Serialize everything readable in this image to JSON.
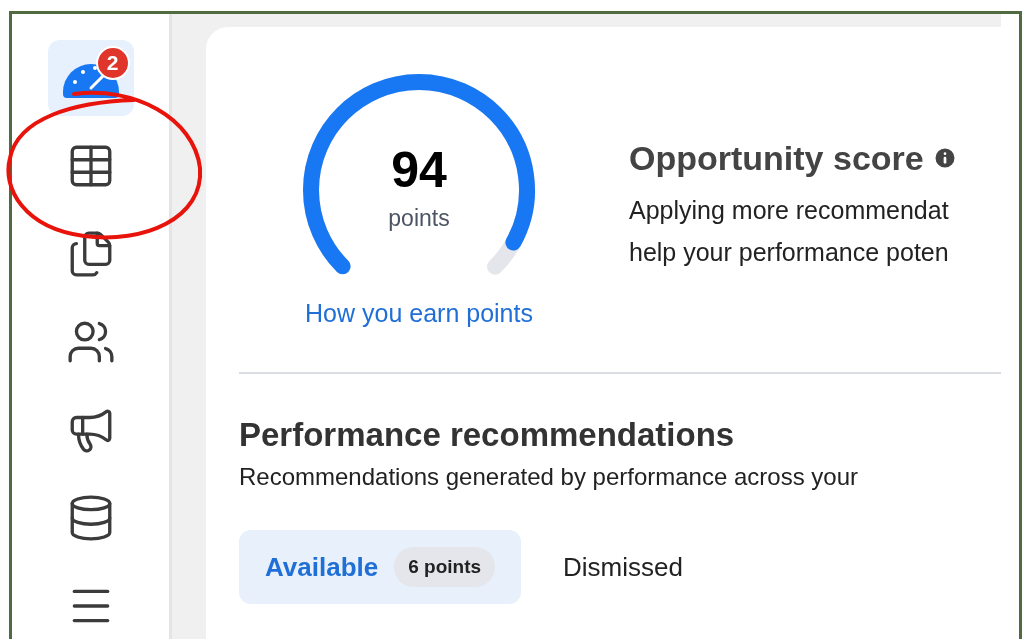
{
  "sidebar": {
    "items": [
      {
        "kind": "gauge",
        "selected": true,
        "badge": "2"
      },
      {
        "kind": "table",
        "selected": false
      },
      {
        "kind": "pages",
        "selected": false
      },
      {
        "kind": "people",
        "selected": false
      },
      {
        "kind": "megaphone",
        "selected": false
      },
      {
        "kind": "coins",
        "selected": false
      },
      {
        "kind": "menu",
        "selected": false
      }
    ]
  },
  "score": {
    "value": "94",
    "unit": "points",
    "level": 0.94,
    "link": "How you earn points",
    "title": "Opportunity score",
    "description_lines": [
      "Applying more recommendat",
      "help your performance poten"
    ]
  },
  "recommendations": {
    "title": "Performance recommendations",
    "subtitle": "Recommendations generated by performance across your",
    "tabs": [
      {
        "label": "Available",
        "badge": "6 points",
        "selected": true
      },
      {
        "label": "Dismissed",
        "selected": false
      }
    ]
  }
}
